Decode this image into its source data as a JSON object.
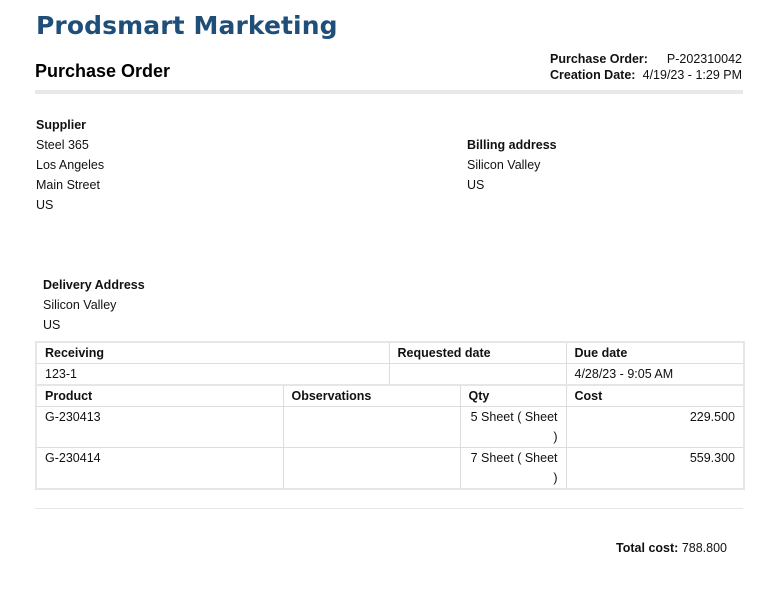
{
  "company": "Prodsmart Marketing",
  "doc_title": "Purchase Order",
  "meta": {
    "po_label": "Purchase Order:",
    "po_value": "P-202310042",
    "date_label": "Creation Date:",
    "date_value": "4/19/23 - 1:29 PM"
  },
  "supplier": {
    "heading": "Supplier",
    "lines": [
      "Steel 365",
      "Los Angeles",
      "Main Street",
      "US"
    ]
  },
  "billing": {
    "heading": "Billing address",
    "lines": [
      "Silicon Valley",
      "US"
    ]
  },
  "delivery": {
    "heading": "Delivery Address",
    "lines": [
      "Silicon Valley",
      "US"
    ]
  },
  "receiving_table": {
    "headers": [
      "Receiving",
      "Requested date",
      "Due date"
    ],
    "row": [
      "123-1",
      "",
      "4/28/23 - 9:05 AM"
    ]
  },
  "items_table": {
    "headers": [
      "Product",
      "Observations",
      "Qty",
      "Cost"
    ],
    "rows": [
      [
        "G-230413",
        "",
        "5 Sheet ( Sheet )",
        "229.500"
      ],
      [
        "G-230414",
        "",
        "7 Sheet ( Sheet )",
        "559.300"
      ]
    ]
  },
  "total": {
    "label": "Total cost:",
    "value": "788.800"
  }
}
